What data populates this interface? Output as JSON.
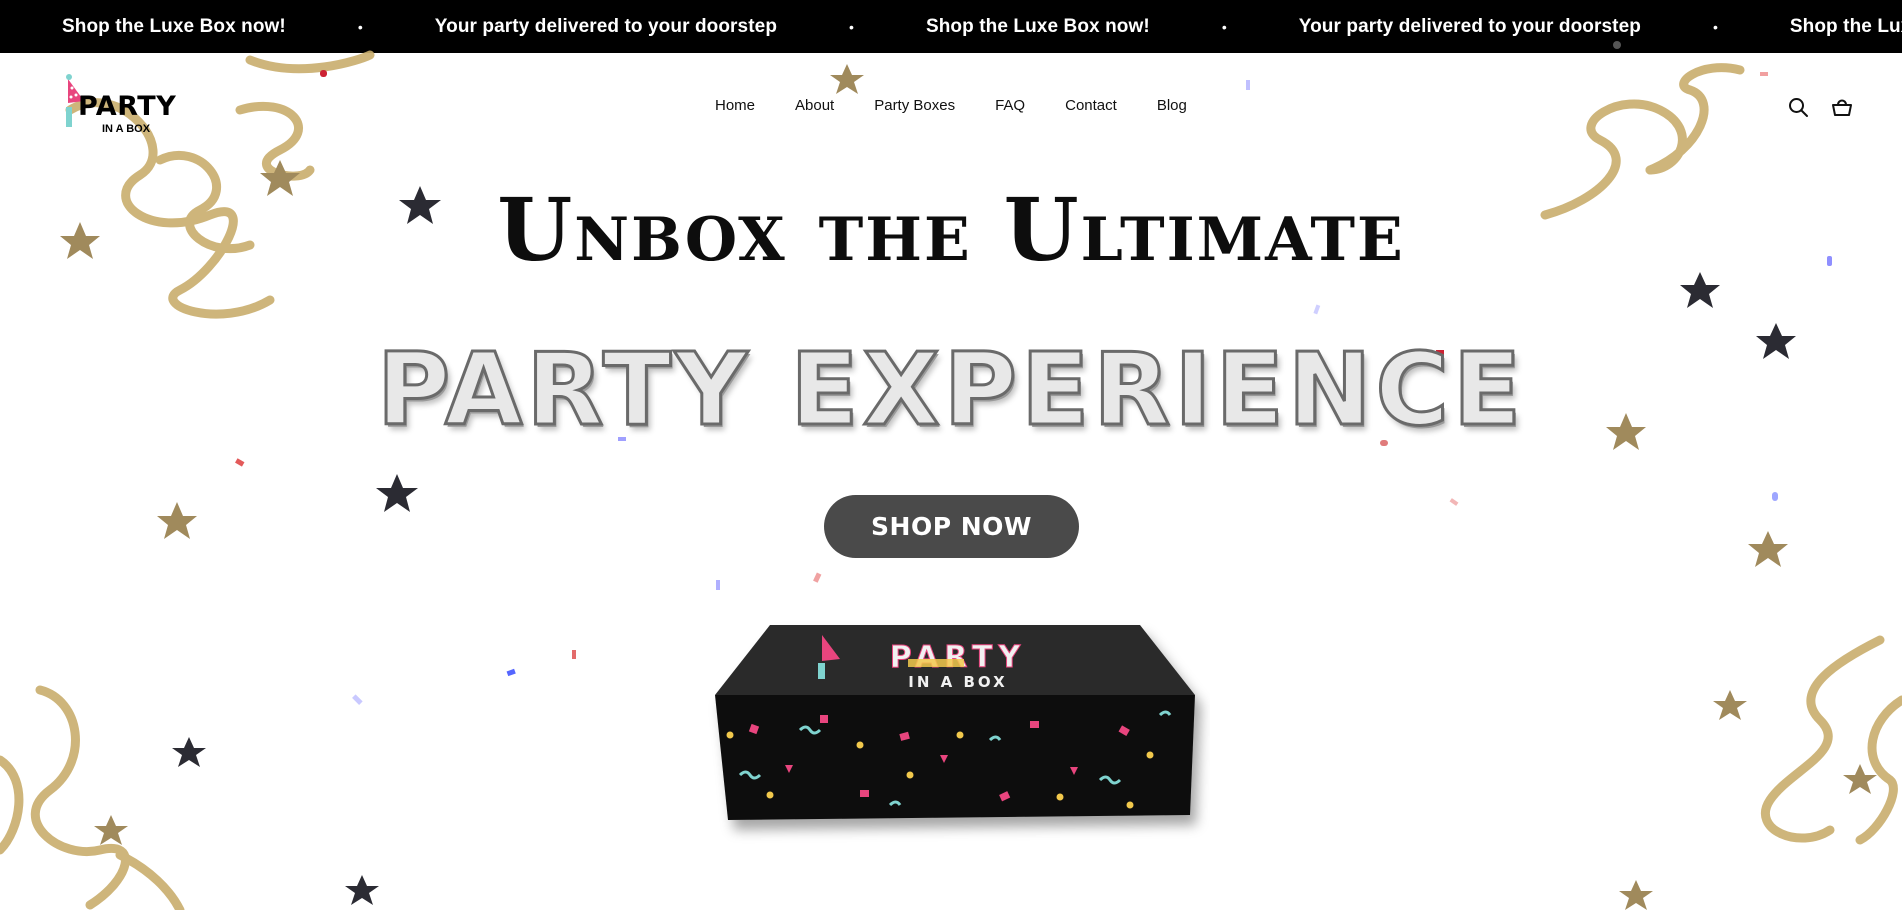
{
  "announcement": {
    "messages": [
      "Shop the Luxe Box now!",
      "Your party delivered to your doorstep",
      "Shop the Luxe Box now!",
      "Your party delivered to your doorstep",
      "Shop the Luxe Box now!"
    ],
    "separator": "•"
  },
  "logo": {
    "word": "PARTY",
    "sub": "IN A BOX"
  },
  "nav": {
    "items": [
      "Home",
      "About",
      "Party Boxes",
      "FAQ",
      "Contact",
      "Blog"
    ]
  },
  "icons": {
    "search": "search-icon",
    "cart": "cart-icon"
  },
  "hero": {
    "line1": "Unbox the Ultimate",
    "line2": "PARTY EXPERIENCE",
    "cta": "SHOP NOW"
  },
  "product": {
    "box_word": "PARTY",
    "box_sub": "IN A BOX"
  },
  "colors": {
    "announcement_bg": "#000000",
    "cta_bg": "#4a4a4a",
    "gold": "#c9ae6d",
    "star_dark": "#2b2b33",
    "pink": "#e8457e",
    "teal": "#7fd3cf",
    "yellow": "#f2c94c"
  }
}
